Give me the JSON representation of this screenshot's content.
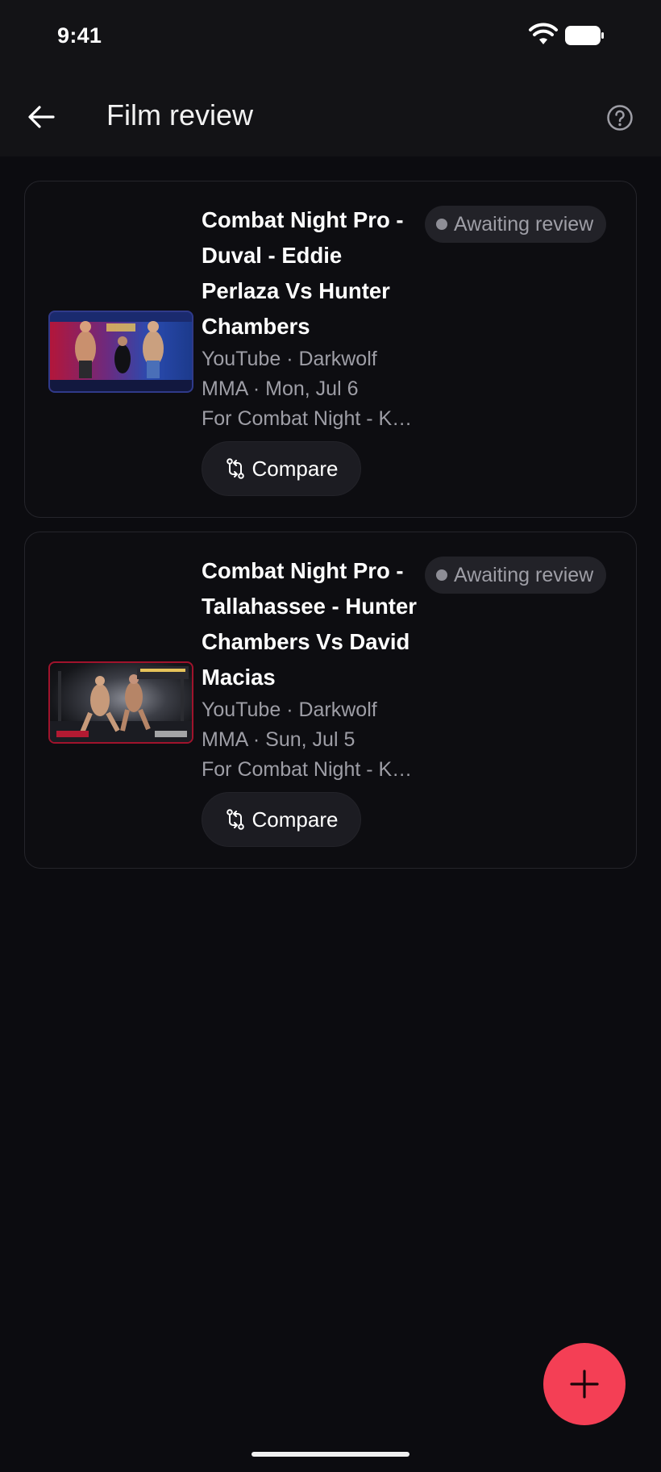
{
  "status_bar": {
    "time": "9:41",
    "icons": [
      "wifi-icon",
      "battery-icon"
    ]
  },
  "app_bar": {
    "back_icon": "arrow-left-icon",
    "title": "Film review",
    "help_icon": "help-circle-icon"
  },
  "cards": [
    {
      "title": "Combat Night Pro - Duval - Eddie Perlaza Vs Hunter Chambers",
      "meta": "YouTube · Darkwolf MMA · Mon, Jul 6",
      "description": "For Combat Night - K…",
      "status": "Awaiting review",
      "compare_label": "Compare",
      "thumbnail_icon": "video-thumbnail"
    },
    {
      "title": "Combat Night Pro - Tallahassee - Hunter Chambers Vs David Macias",
      "meta": "YouTube · Darkwolf MMA · Sun, Jul 5",
      "description": "For Combat Night - K…",
      "status": "Awaiting review",
      "compare_label": "Compare",
      "thumbnail_icon": "video-thumbnail"
    }
  ],
  "fab": {
    "icon": "plus-icon"
  },
  "colors": {
    "background": "#0c0c10",
    "bar": "#131316",
    "accent": "#f43f55",
    "muted_text": "#9e9ea6",
    "badge_bg": "#222228"
  }
}
